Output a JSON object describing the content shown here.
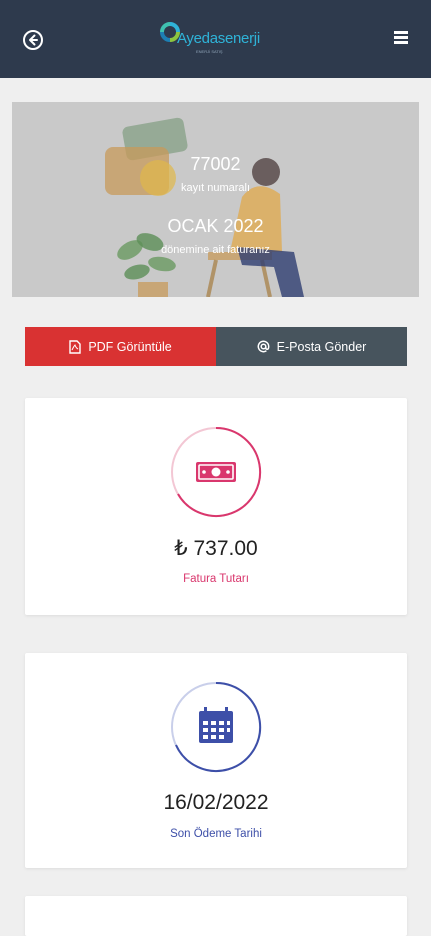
{
  "header": {
    "back_icon": "back-arrow-circle-icon",
    "logo_text": "Ayedasenerji",
    "logo_sub": "ENERJİ SATIŞ",
    "menu_icon": "hamburger-menu-icon",
    "bg_color": "#2e3a4d"
  },
  "hero": {
    "number": "77002",
    "number_label": "kayıt numaralı",
    "period": "OCAK 2022",
    "period_label": "dönemine ait faturanız"
  },
  "actions": {
    "pdf_label": "PDF Görüntüle",
    "pdf_icon": "pdf-file-icon",
    "pdf_color": "#d93232",
    "email_label": "E-Posta Gönder",
    "email_icon": "at-sign-icon",
    "email_color": "#47545d"
  },
  "cards": {
    "amount": {
      "value": "₺ 737.00",
      "label": "Fatura Tutarı",
      "icon": "money-bill-icon",
      "accent": "#d9376d"
    },
    "due_date": {
      "value": "16/02/2022",
      "label": "Son Ödeme Tarihi",
      "icon": "calendar-icon",
      "accent": "#3d4fa8"
    }
  }
}
